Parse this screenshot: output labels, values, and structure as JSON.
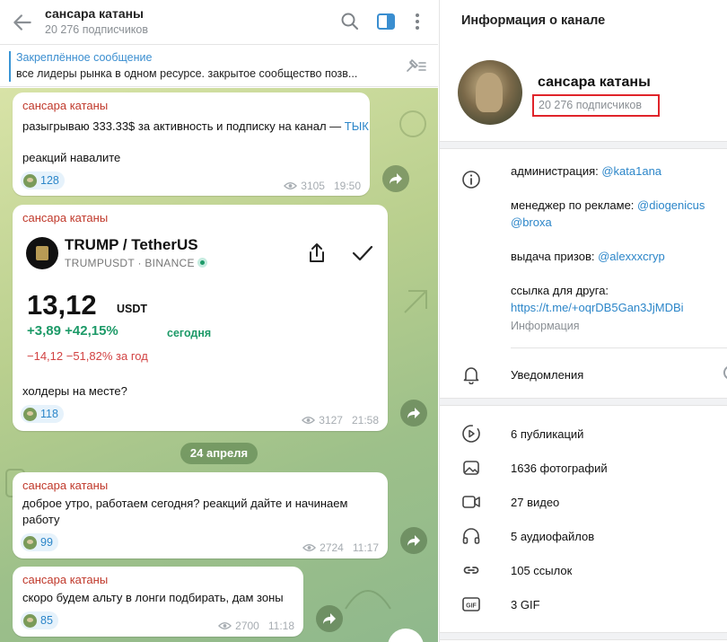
{
  "chat": {
    "title": "сансара катаны",
    "subscribers": "20 276 подписчиков",
    "pinned_title": "Закреплённое сообщение",
    "pinned_text": "все лидеры рынка в одном ресурсе.  закрытое сообщество позв..."
  },
  "messages": [
    {
      "author": "сансара катаны",
      "text": "разыгрываю 333.33$ за активность и подписку на канал — ",
      "link": "ТЫК",
      "text2": "реакций навалите",
      "reactions": "128",
      "views": "3105",
      "time": "19:50"
    },
    {
      "author": "сансара катаны",
      "ticker_title": "TRUMP / TetherUS",
      "ticker_sub": "TRUMPUSDT · BINANCE",
      "price": "13,12",
      "price_unit": "USDT",
      "change_pos": "+3,89  +42,15%",
      "change_pos_label": "сегодня",
      "change_neg": "−14,12  −51,82% за год",
      "text": "холдеры на месте?",
      "reactions": "118",
      "views": "3127",
      "time": "21:58"
    },
    {
      "author": "сансара катаны",
      "text": "доброе утро, работаем сегодня? реакций дайте и начинаем",
      "text2": "работу",
      "reactions": "99",
      "views": "2724",
      "time": "11:17"
    },
    {
      "author": "сансара катаны",
      "text": "скоро будем альту в лонги подбирать, дам зоны",
      "reactions": "85",
      "views": "2700",
      "time": "11:18"
    }
  ],
  "date_separator": "24 апреля",
  "info": {
    "title": "Информация о канале",
    "name": "сансара катаны",
    "subscribers": "20 276 подписчиков",
    "admin_label": "администрация: ",
    "admin_link": "@kata1ana",
    "manager_label": "менеджер по рекламе: ",
    "manager_link": "@diogenicus",
    "manager_link2": "@broxa",
    "prizes_label": "выдача призов: ",
    "prizes_link": "@alexxxcryp",
    "friend_label": "ссылка для друга:",
    "friend_link": "https://t.me/+oqrDB5Gan3JjMDBi",
    "info_caption": "Информация",
    "notifications": "Уведомления",
    "media": [
      {
        "icon": "play-circle-icon",
        "label": "6 публикаций"
      },
      {
        "icon": "photo-icon",
        "label": "1636 фотографий"
      },
      {
        "icon": "video-icon",
        "label": "27 видео"
      },
      {
        "icon": "headphones-icon",
        "label": "5 аудиофайлов"
      },
      {
        "icon": "link-icon",
        "label": "105 ссылок"
      },
      {
        "icon": "gif-icon",
        "label": "3 GIF"
      }
    ]
  },
  "colors": {
    "accent": "#2c86c9",
    "author": "#c0392b",
    "highlight_box": "#e0242a",
    "positive": "#1d9a68",
    "negative": "#d24343"
  }
}
